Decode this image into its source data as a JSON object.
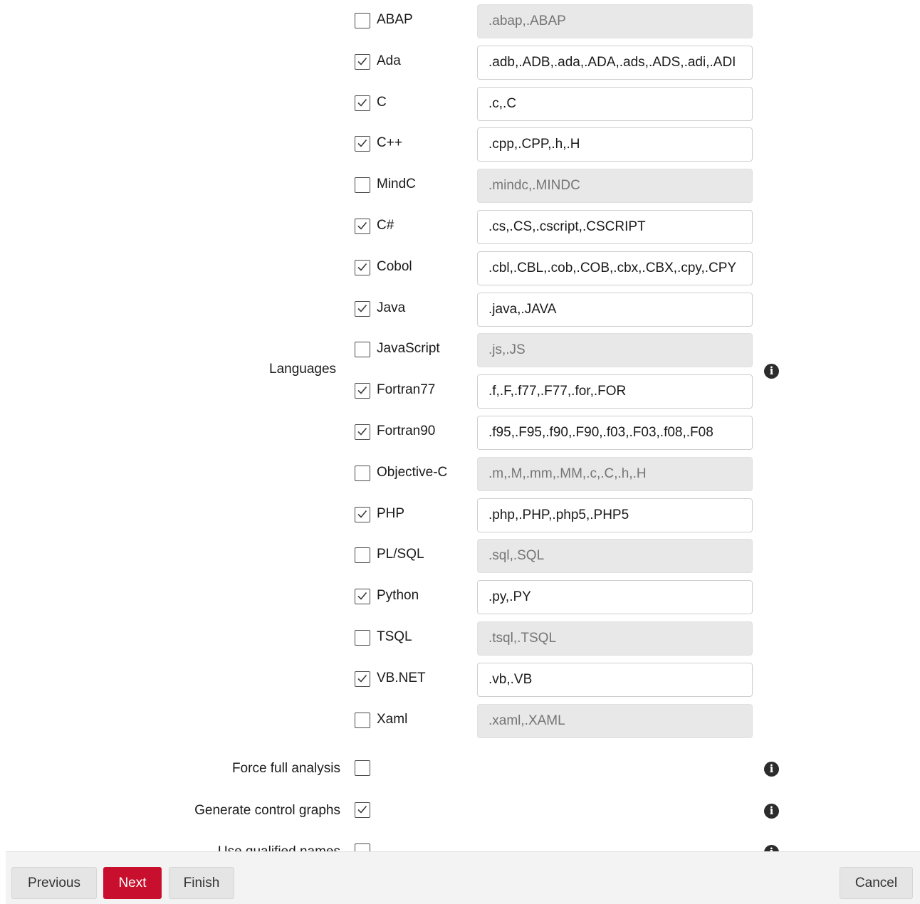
{
  "languages": {
    "label": "Languages",
    "items": [
      {
        "name": "ABAP",
        "checked": false,
        "extensions": ".abap,.ABAP"
      },
      {
        "name": "Ada",
        "checked": true,
        "extensions": ".adb,.ADB,.ada,.ADA,.ads,.ADS,.adi,.ADI"
      },
      {
        "name": "C",
        "checked": true,
        "extensions": ".c,.C"
      },
      {
        "name": "C++",
        "checked": true,
        "extensions": ".cpp,.CPP,.h,.H"
      },
      {
        "name": "MindC",
        "checked": false,
        "extensions": ".mindc,.MINDC"
      },
      {
        "name": "C#",
        "checked": true,
        "extensions": ".cs,.CS,.cscript,.CSCRIPT"
      },
      {
        "name": "Cobol",
        "checked": true,
        "extensions": ".cbl,.CBL,.cob,.COB,.cbx,.CBX,.cpy,.CPY"
      },
      {
        "name": "Java",
        "checked": true,
        "extensions": ".java,.JAVA"
      },
      {
        "name": "JavaScript",
        "checked": false,
        "extensions": ".js,.JS"
      },
      {
        "name": "Fortran77",
        "checked": true,
        "extensions": ".f,.F,.f77,.F77,.for,.FOR"
      },
      {
        "name": "Fortran90",
        "checked": true,
        "extensions": ".f95,.F95,.f90,.F90,.f03,.F03,.f08,.F08"
      },
      {
        "name": "Objective-C",
        "checked": false,
        "extensions": ".m,.M,.mm,.MM,.c,.C,.h,.H"
      },
      {
        "name": "PHP",
        "checked": true,
        "extensions": ".php,.PHP,.php5,.PHP5"
      },
      {
        "name": "PL/SQL",
        "checked": false,
        "extensions": ".sql,.SQL"
      },
      {
        "name": "Python",
        "checked": true,
        "extensions": ".py,.PY"
      },
      {
        "name": "TSQL",
        "checked": false,
        "extensions": ".tsql,.TSQL"
      },
      {
        "name": "VB.NET",
        "checked": true,
        "extensions": ".vb,.VB"
      },
      {
        "name": "Xaml",
        "checked": false,
        "extensions": ".xaml,.XAML"
      }
    ]
  },
  "options": [
    {
      "label": "Force full analysis",
      "checked": false
    },
    {
      "label": "Generate control graphs",
      "checked": true
    },
    {
      "label": "Use qualified names",
      "checked": false
    }
  ],
  "info_icon_glyph": "i",
  "footer": {
    "previous_label": "Previous",
    "next_label": "Next",
    "finish_label": "Finish",
    "cancel_label": "Cancel"
  },
  "colors": {
    "primary_button": "#c8102e",
    "disabled_input": "#e8e8e8"
  }
}
